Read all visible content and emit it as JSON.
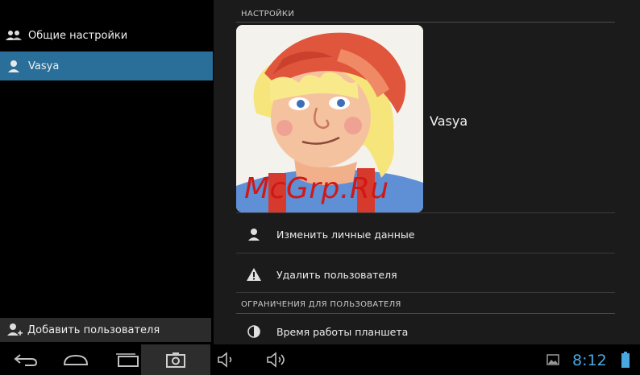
{
  "sidebar": {
    "items": [
      {
        "label": "Общие настройки",
        "icon": "users-group-icon"
      },
      {
        "label": "Vasya",
        "icon": "user-icon"
      }
    ],
    "add_user_label": "Добавить пользователя"
  },
  "main": {
    "settings_header": "НАСТРОЙКИ",
    "profile_name": "Vasya",
    "edit_personal_label": "Изменить личные данные",
    "delete_user_label": "Удалить пользователя",
    "restrictions_header": "ОГРАНИЧЕНИЯ ДЛЯ ПОЛЬЗОВАТЕЛЯ",
    "tablet_time_label": "Время работы планшета"
  },
  "watermark": "McGrp.Ru",
  "status": {
    "time": "8:12"
  },
  "colors": {
    "accent": "#2a6f9a",
    "clock": "#4aa8e0",
    "watermark": "#d21717"
  }
}
